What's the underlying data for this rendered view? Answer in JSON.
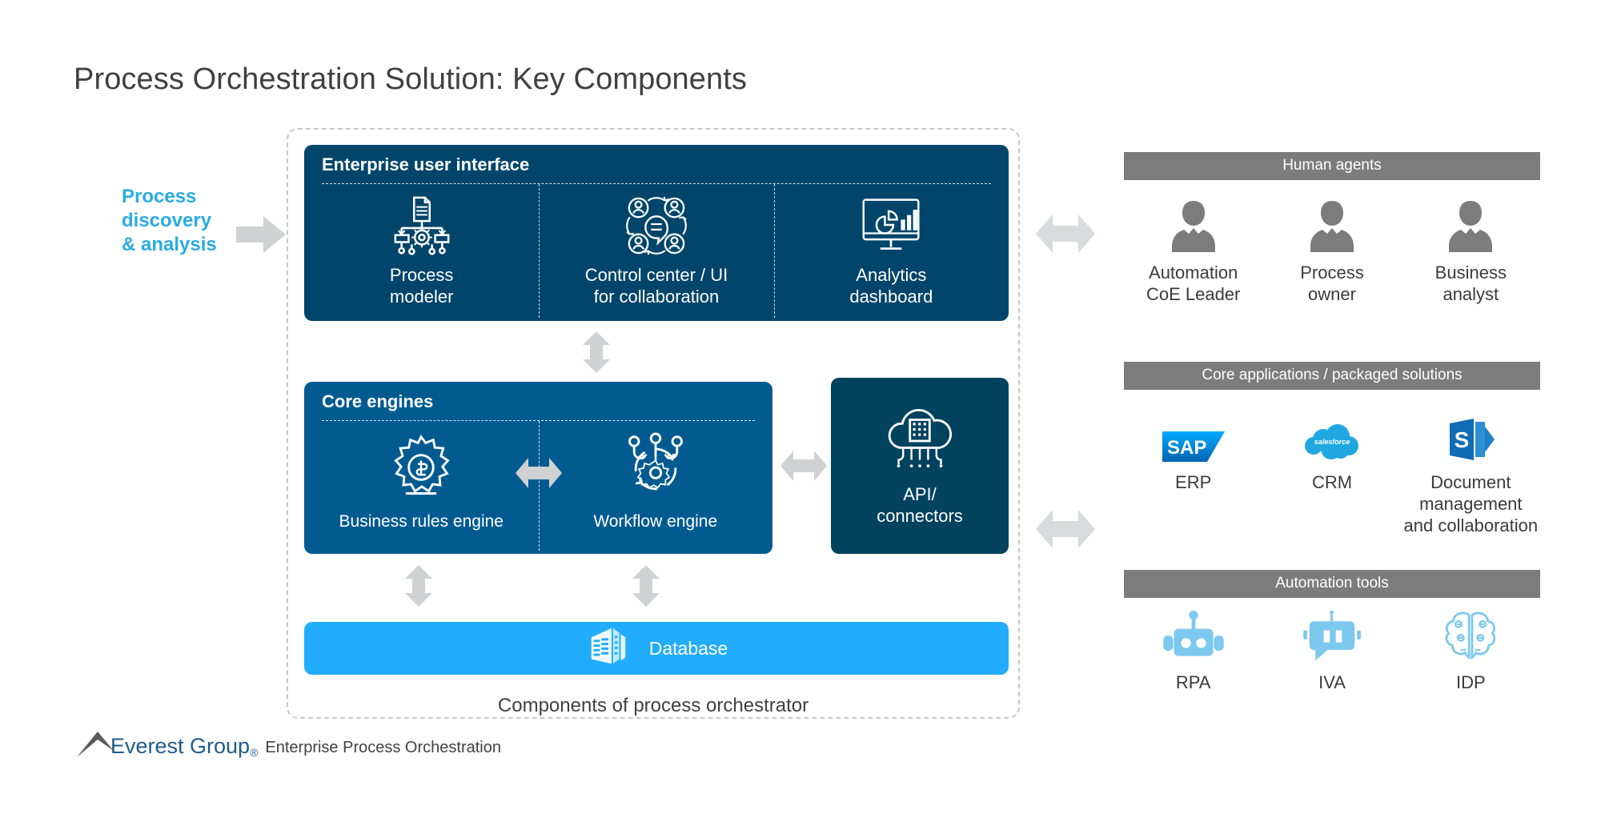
{
  "title": "Process Orchestration Solution: Key Components",
  "left_input": {
    "label_line1": "Process",
    "label_line2": "discovery",
    "label_line3": "& analysis",
    "color": "#29abe2"
  },
  "orchestrator": {
    "caption": "Components of process orchestrator",
    "panels": {
      "enterprise_ui": {
        "heading": "Enterprise user interface",
        "color": "#01456b",
        "items": [
          {
            "icon": "process-modeler-icon",
            "label_line1": "Process",
            "label_line2": "modeler"
          },
          {
            "icon": "collaboration-users-icon",
            "label_line1": "Control center / UI",
            "label_line2": "for collaboration"
          },
          {
            "icon": "analytics-dashboard-icon",
            "label_line1": "Analytics",
            "label_line2": "dashboard"
          }
        ]
      },
      "core_engines": {
        "heading": "Core engines",
        "color": "#015b91",
        "items": [
          {
            "icon": "business-rules-gear-icon",
            "label": "Business rules engine"
          },
          {
            "icon": "workflow-gear-icon",
            "label": "Workflow engine"
          }
        ]
      },
      "api_connectors": {
        "icon": "cloud-api-icon",
        "label_line1": "API/",
        "label_line2": "connectors",
        "color": "#01425f"
      },
      "database": {
        "icon": "database-icon",
        "label": "Database",
        "color": "#22acfd"
      }
    }
  },
  "right_groups": [
    {
      "id": "human-agents",
      "heading": "Human agents",
      "header_color": "#7c7c7c",
      "items": [
        {
          "icon": "person-icon",
          "label_line1": "Automation",
          "label_line2": "CoE Leader"
        },
        {
          "icon": "person-icon",
          "label_line1": "Process",
          "label_line2": "owner"
        },
        {
          "icon": "person-icon",
          "label_line1": "Business",
          "label_line2": "analyst"
        }
      ]
    },
    {
      "id": "core-applications",
      "heading": "Core applications / packaged solutions",
      "header_color": "#7c7c7c",
      "items": [
        {
          "icon": "sap-logo-icon",
          "label_line1": "ERP",
          "label_line2": "",
          "label_line3": ""
        },
        {
          "icon": "salesforce-logo-icon",
          "label_line1": "CRM",
          "label_line2": "",
          "label_line3": ""
        },
        {
          "icon": "sharepoint-logo-icon",
          "label_line1": "Document",
          "label_line2": "management",
          "label_line3": "and collaboration"
        }
      ]
    },
    {
      "id": "automation-tools",
      "heading": "Automation tools",
      "header_color": "#7c7c7c",
      "items": [
        {
          "icon": "robot-icon",
          "label_line1": "RPA"
        },
        {
          "icon": "chatbot-icon",
          "label_line1": "IVA"
        },
        {
          "icon": "brain-circuit-icon",
          "label_line1": "IDP"
        }
      ]
    }
  ],
  "footer": {
    "brand": "Everest Group",
    "registered_mark": "®",
    "subtitle": "Enterprise Process Orchestration",
    "brand_color": "#1f5c8b"
  }
}
